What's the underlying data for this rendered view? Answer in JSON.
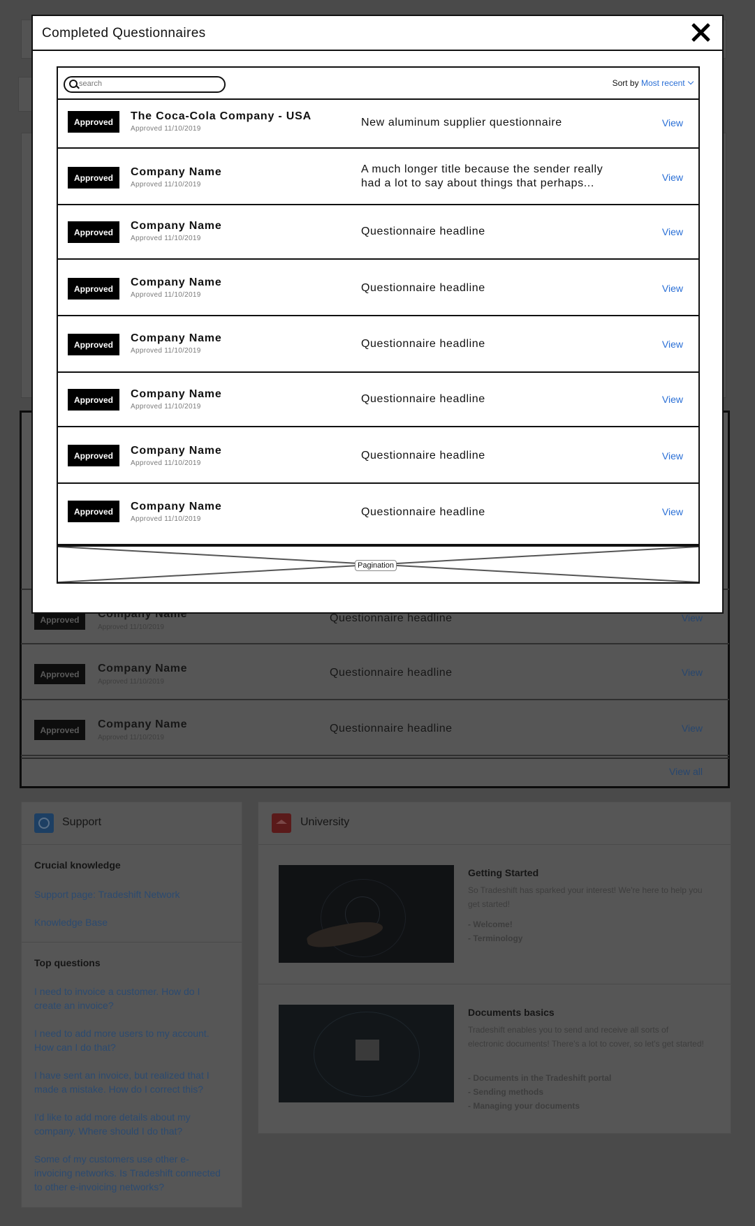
{
  "background": {
    "rows": [
      {
        "status": "Approved",
        "company": "Company Name",
        "date": "Approved 11/10/2019",
        "headline": "Questionnaire headline",
        "view": "View"
      },
      {
        "status": "Approved",
        "company": "Company Name",
        "date": "Approved 11/10/2019",
        "headline": "Questionnaire headline",
        "view": "View"
      },
      {
        "status": "Approved",
        "company": "Company Name",
        "date": "Approved 11/10/2019",
        "headline": "Questionnaire headline",
        "view": "View"
      }
    ],
    "view_all": "View all",
    "support": {
      "title": "Support",
      "crucial_heading": "Crucial knowledge",
      "links": [
        "Support page: Tradeshift Network",
        "Knowledge Base"
      ],
      "top_questions_heading": "Top questions",
      "questions": [
        "I need to invoice a customer. How do I create an invoice?",
        "I need to add more users to my account. How can I do that?",
        "I have sent an invoice, but realized that I made a mistake. How do I correct this?",
        "I'd like to add more details about my company. Where should I do that?",
        "Some of my customers use other e-invoicing networks. Is Tradeshift connected to other e-invoicing networks?"
      ]
    },
    "university": {
      "title": "University",
      "courses": [
        {
          "title": "Getting Started",
          "desc": "So Tradeshift has sparked your interest! We're here to help you get started!",
          "items": [
            "- Welcome!",
            "- Terminology"
          ]
        },
        {
          "title": "Documents basics",
          "desc": "Tradeshift enables you to send and receive all sorts of electronic documents! There's a lot to cover, so let's get started!",
          "items": [
            "- Documents in the Tradeshift portal",
            "- Sending methods",
            "- Managing your documents"
          ]
        }
      ]
    }
  },
  "modal": {
    "title": "Completed Questionnaires",
    "search_placeholder": "search",
    "sort_label": "Sort by",
    "sort_value": "Most recent",
    "rows": [
      {
        "status": "Approved",
        "company": "The Coca-Cola Company - USA",
        "date": "Approved 11/10/2019",
        "headline": "New aluminum supplier questionnaire",
        "view": "View"
      },
      {
        "status": "Approved",
        "company": "Company Name",
        "date": "Approved 11/10/2019",
        "headline": "A much longer title because the sender really had a lot to say about things that perhaps...",
        "view": "View"
      },
      {
        "status": "Approved",
        "company": "Company Name",
        "date": "Approved 11/10/2019",
        "headline": "Questionnaire headline",
        "view": "View"
      },
      {
        "status": "Approved",
        "company": "Company Name",
        "date": "Approved 11/10/2019",
        "headline": "Questionnaire headline",
        "view": "View"
      },
      {
        "status": "Approved",
        "company": "Company Name",
        "date": "Approved 11/10/2019",
        "headline": "Questionnaire headline",
        "view": "View"
      },
      {
        "status": "Approved",
        "company": "Company Name",
        "date": "Approved 11/10/2019",
        "headline": "Questionnaire headline",
        "view": "View"
      },
      {
        "status": "Approved",
        "company": "Company Name",
        "date": "Approved 11/10/2019",
        "headline": "Questionnaire headline",
        "view": "View"
      },
      {
        "status": "Approved",
        "company": "Company Name",
        "date": "Approved 11/10/2019",
        "headline": "Questionnaire headline",
        "view": "View"
      }
    ],
    "pagination_label": "Pagination"
  },
  "colors": {
    "overlay": "#4a4a4a",
    "accent": "#2a6fd6",
    "badge": "#000000"
  }
}
